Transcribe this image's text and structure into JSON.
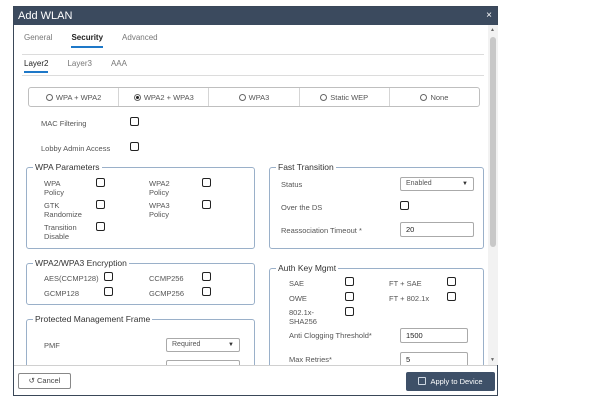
{
  "dialog": {
    "title": "Add WLAN",
    "close": "×"
  },
  "tabs": [
    "General",
    "Security",
    "Advanced"
  ],
  "subtabs": [
    "Layer2",
    "Layer3",
    "AAA"
  ],
  "security_modes": [
    {
      "label": "WPA + WPA2",
      "selected": false
    },
    {
      "label": "WPA2 + WPA3",
      "selected": true
    },
    {
      "label": "WPA3",
      "selected": false
    },
    {
      "label": "Static WEP",
      "selected": false
    },
    {
      "label": "None",
      "selected": false
    }
  ],
  "mac_filtering": "MAC Filtering",
  "lobby_admin_access": "Lobby Admin Access",
  "wpa_parameters": {
    "title": "WPA Parameters",
    "wpa_policy": "WPA\nPolicy",
    "wpa2_policy": "WPA2\nPolicy",
    "gtk_randomize": "GTK\nRandomize",
    "wpa3_policy": "WPA3\nPolicy",
    "transition_disable": "Transition\nDisable"
  },
  "encryption": {
    "title": "WPA2/WPA3 Encryption",
    "aes": "AES(CCMP128)",
    "ccmp256": "CCMP256",
    "gcmp128": "GCMP128",
    "gcmp256": "GCMP256"
  },
  "pmf": {
    "title": "Protected Management Frame",
    "label": "PMF",
    "value": "Required"
  },
  "fast_transition": {
    "title": "Fast Transition",
    "status_label": "Status",
    "status_value": "Enabled",
    "over_ds": "Over the DS",
    "reassoc_label": "Reassociation Timeout *",
    "reassoc_value": "20"
  },
  "auth_key_mgmt": {
    "title": "Auth Key Mgmt",
    "sae": "SAE",
    "ft_sae": "FT + SAE",
    "owe": "OWE",
    "ft_8021x": "FT + 802.1x",
    "dot1x_sha256": "802.1x-\nSHA256",
    "anti_clogging_label": "Anti Clogging Threshold*",
    "anti_clogging_value": "1500",
    "max_retries_label": "Max Retries*",
    "max_retries_value": "5"
  },
  "footer": {
    "cancel": "Cancel",
    "apply": "Apply to Device"
  },
  "colors": {
    "titlebar": "#3b4a5e",
    "accent": "#1e78c8",
    "apply_button": "#3e5068"
  }
}
